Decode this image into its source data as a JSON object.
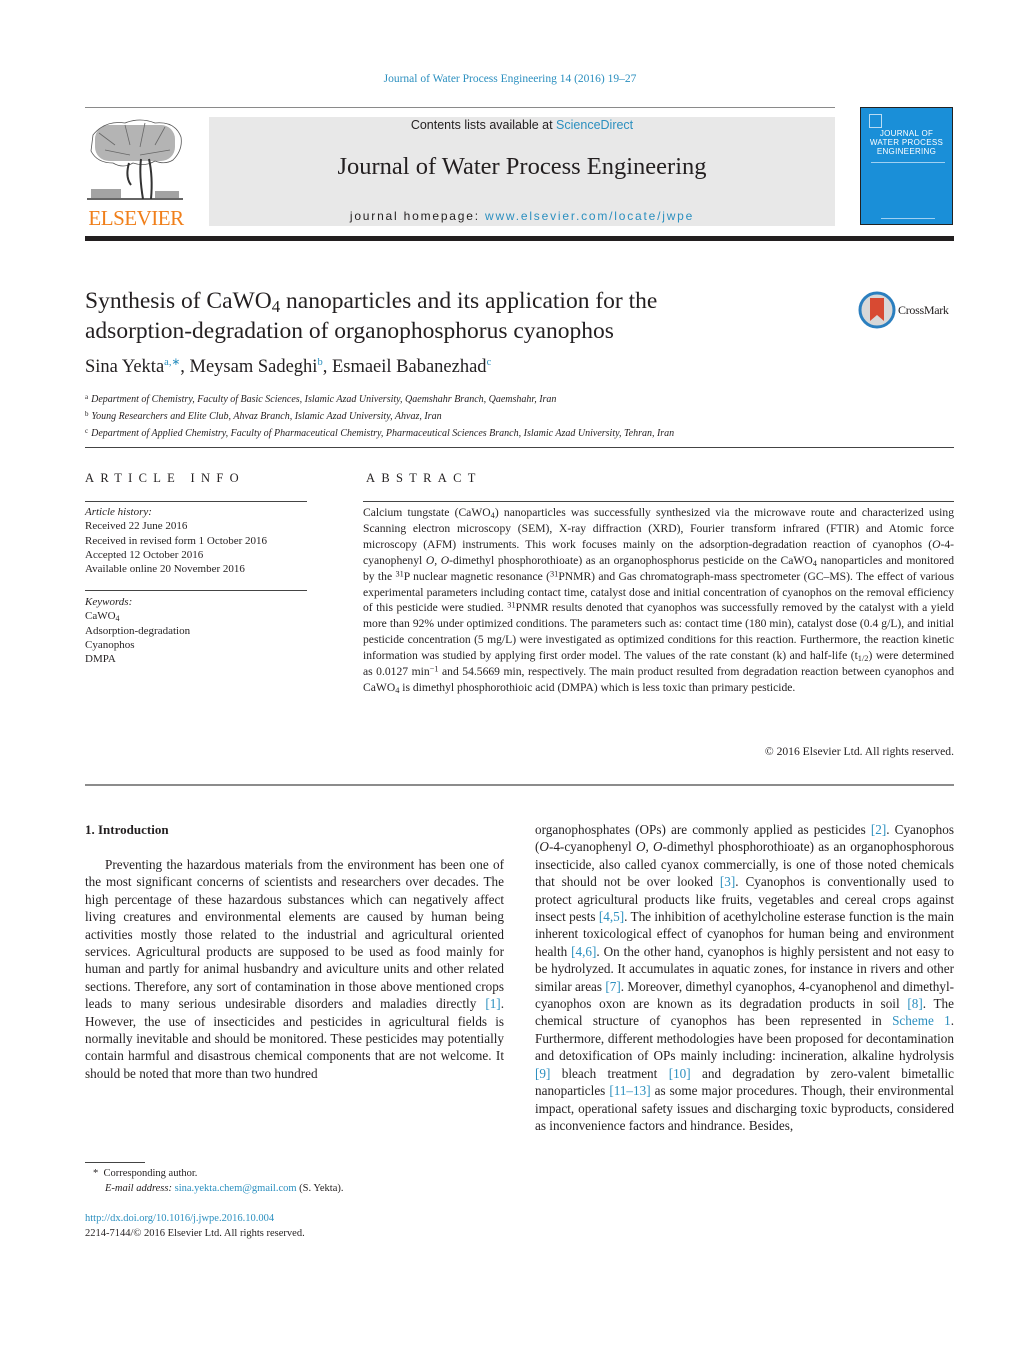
{
  "running_header": "Journal of Water Process Engineering 14 (2016) 19–27",
  "masthead": {
    "publisher_logo_text": "ELSEVIER",
    "contents_prefix": "Contents lists available at ",
    "contents_link": "ScienceDirect",
    "journal_name": "Journal of Water Process Engineering",
    "homepage_prefix": "journal homepage: ",
    "homepage_link": "www.elsevier.com/locate/jwpe",
    "cover_title_lines": [
      "JOURNAL OF",
      "WATER PROCESS",
      "ENGINEERING"
    ],
    "cover_color": "#1a8fd8",
    "publisher_color": "#f07f1a",
    "link_color": "#2b8fbf"
  },
  "article": {
    "title_part1": "Synthesis of CaWO",
    "title_sub": "4",
    "title_part2": " nanoparticles and its application for the",
    "title_line2": "adsorption-degradation of organophosphorus cyanophos",
    "crossmark_label": "CrossMark",
    "authors": [
      {
        "name": "Sina Yekta",
        "sup": "a,∗"
      },
      {
        "name": "Meysam Sadeghi",
        "sup": "b"
      },
      {
        "name": "Esmaeil Babanezhad",
        "sup": "c"
      }
    ],
    "affiliations": [
      {
        "key": "a",
        "text": "Department of Chemistry, Faculty of Basic Sciences, Islamic Azad University, Qaemshahr Branch, Qaemshahr, Iran"
      },
      {
        "key": "b",
        "text": "Young Researchers and Elite Club, Ahvaz Branch, Islamic Azad University, Ahvaz, Iran"
      },
      {
        "key": "c",
        "text": "Department of Applied Chemistry, Faculty of Pharmaceutical Chemistry, Pharmaceutical Sciences Branch, Islamic Azad University, Tehran, Iran"
      }
    ]
  },
  "article_info": {
    "heading": "ARTICLE INFO",
    "history_label": "Article history:",
    "history": [
      "Received 22 June 2016",
      "Received in revised form 1 October 2016",
      "Accepted 12 October 2016",
      "Available online 20 November 2016"
    ],
    "keywords_label": "Keywords:",
    "keyword_cawo": "CaWO",
    "keyword_cawo_sub": "4",
    "keywords": [
      "Adsorption-degradation",
      "Cyanophos",
      "DMPA"
    ]
  },
  "abstract": {
    "heading": "ABSTRACT",
    "s1a": "Calcium tungstate (CaWO",
    "s1b": ") nanoparticles was successfully synthesized via the microwave route and characterized using Scanning electron microscopy (SEM), X-ray diffraction (XRD), Fourier transform infrared (FTIR) and Atomic force microscopy (AFM) instruments. This work focuses mainly on the adsorption-degradation reaction of cyanophos (",
    "s1c": "O",
    "s1d": "-4-cyanophenyl ",
    "s1e": "O, O",
    "s1f": "-dimethyl phosphorothioate) as an organophosphorus pesticide on the CaWO",
    "s1g": " nanoparticles and monitored by the ",
    "s1h": "P nuclear magnetic resonance (",
    "s1i": "PNMR) and Gas chromatograph-mass spectrometer (GC–MS). The effect of various experimental parameters including contact time, catalyst dose and initial concentration of cyanophos on the removal efficiency of this pesticide were studied. ",
    "s1j": "PNMR results denoted that cyanophos was successfully removed by the catalyst with a yield more than 92% under optimized conditions. The parameters such as: contact time (180 min), catalyst dose (0.4 g/L), and initial pesticide concentration (5 mg/L) were investigated as optimized conditions for this reaction. Furthermore, the reaction kinetic information was studied by applying first order model. The values of the rate constant (k) and half-life (t",
    "s1k": ") were determined as 0.0127 min",
    "s1l": " and 54.5669 min, respectively. The main product resulted from degradation reaction between cyanophos and CaWO",
    "s1m": " is dimethyl phosphorothioic acid (DMPA) which is less toxic than primary pesticide.",
    "sub4": "4",
    "sup31": "31",
    "sub_half": "1/2",
    "sup_minus1": "−1",
    "copyright": "© 2016 Elsevier Ltd. All rights reserved."
  },
  "introduction": {
    "heading": "1.  Introduction",
    "left_p1": "Preventing the hazardous materials from the environment has been one of the most significant concerns of scientists and researchers over decades. The high percentage of these hazardous substances which can negatively affect living creatures and environmental elements are caused by human being activities mostly those related to the industrial and agricultural oriented services. Agricultural products are supposed to be used as food mainly for human and partly for animal husbandry and aviculture units and other related sections. Therefore, any sort of contamination in those above mentioned crops leads to many serious undesirable disorders and maladies directly ",
    "ref1": "[1]",
    "left_p2": ". However, the use of insecticides and pesticides in agricultural fields is normally inevitable and should be monitored. These pesticides may potentially contain harmful and disastrous chemical components that are not welcome. It should be noted that more than two hundred",
    "r1": "organophosphates (OPs) are commonly applied as pesticides ",
    "ref2": "[2]",
    "r2": ". Cyanophos (",
    "r2_it1": "O",
    "r3": "-4-cyanophenyl ",
    "r3_it2": "O, O",
    "r4": "-dimethyl phosphorothioate) as an organophosphorous insecticide, also called cyanox commercially, is one of those noted chemicals that should not be over looked ",
    "ref3": "[3]",
    "r5": ". Cyanophos is conventionally used to protect agricultural products like fruits, vegetables and cereal crops against insect pests ",
    "ref45": "[4,5]",
    "r6": ". The inhibition of acethylcholine esterase function is the main inherent toxicological effect of cyanophos for human being and environment health ",
    "ref46": "[4,6]",
    "r7": ". On the other hand, cyanophos is highly persistent and not easy to be hydrolyzed. It accumulates in aquatic zones, for instance in rivers and other similar areas ",
    "ref7": "[7]",
    "r8": ". Moreover, dimethyl cyanophos, 4-cyanophenol and dimethyl-cyanophos oxon are known as its degradation products in soil ",
    "ref8": "[8]",
    "r9": ". The chemical structure of cyanophos has been represented in ",
    "scheme1": "Scheme 1",
    "r10": ". Furthermore, different methodologies have been proposed for decontamination and detoxification of OPs mainly including: incineration, alkaline hydrolysis ",
    "ref9": "[9]",
    "r11": " bleach treatment ",
    "ref10": "[10]",
    "r12": " and degradation by zero-valent bimetallic nanoparticles ",
    "ref1113": "[11–13]",
    "r13": " as some major procedures. Though, their environmental impact, operational safety issues and discharging toxic byproducts, considered as inconvenience factors and hindrance. Besides,"
  },
  "footnote": {
    "marker": "*",
    "corresponding": "Corresponding author.",
    "email_label": "E-mail address:",
    "email": "sina.yekta.chem@gmail.com",
    "email_suffix": " (S. Yekta)."
  },
  "doi": {
    "link": "http://dx.doi.org/10.1016/j.jwpe.2016.10.004",
    "issn_line": "2214-7144/© 2016 Elsevier Ltd. All rights reserved."
  }
}
